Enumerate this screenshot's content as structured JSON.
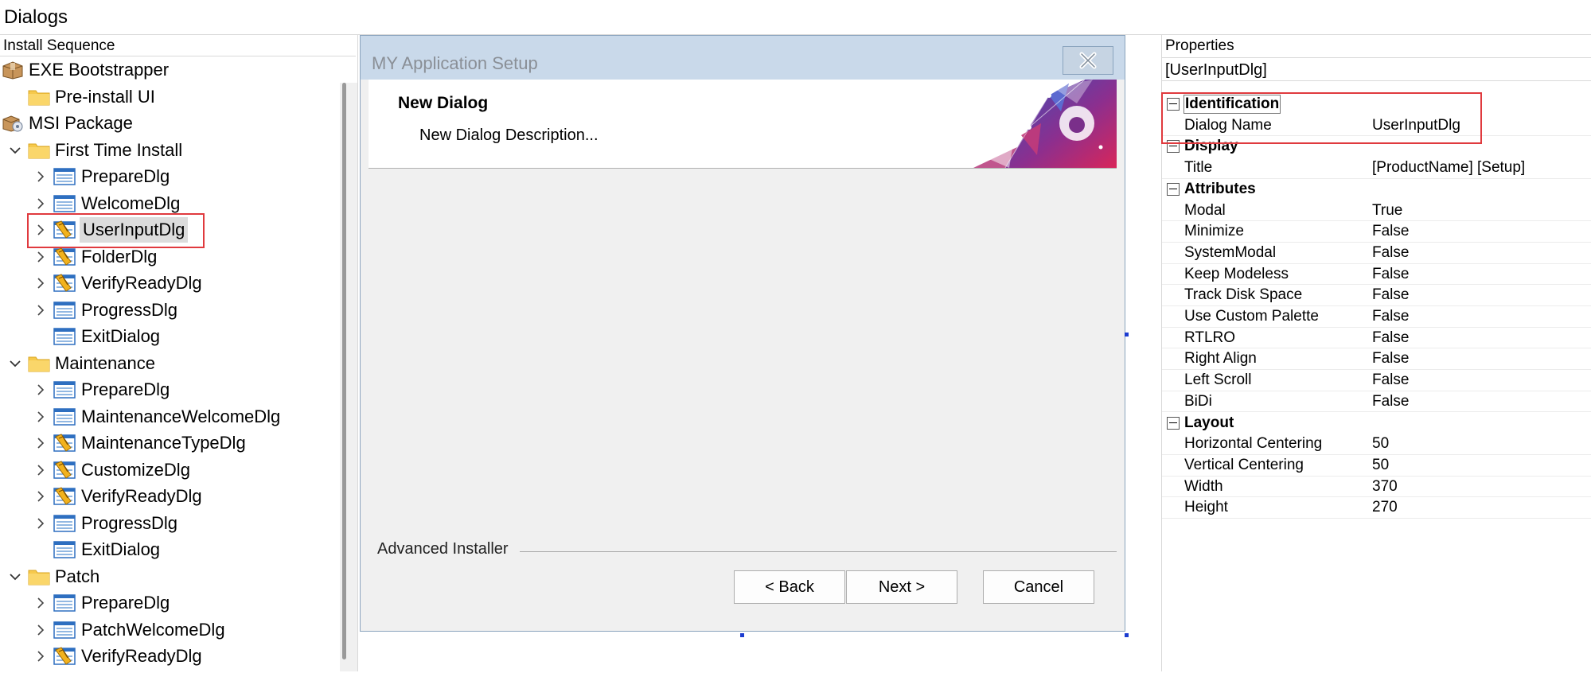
{
  "page": {
    "title": "Dialogs"
  },
  "left_panel": {
    "header": "Install Sequence",
    "tree": [
      {
        "label": "EXE Bootstrapper",
        "icon": "package-icon",
        "depth": 0,
        "chevron": "none"
      },
      {
        "label": "Pre-install UI",
        "icon": "folder-icon",
        "depth": 1,
        "chevron": "none"
      },
      {
        "label": "MSI Package",
        "icon": "msi-package-icon",
        "depth": 0,
        "chevron": "none"
      },
      {
        "label": "First Time Install",
        "icon": "folder-icon",
        "depth": 1,
        "chevron": "expanded"
      },
      {
        "label": "PrepareDlg",
        "icon": "dialog-icon",
        "depth": 2,
        "chevron": "collapsed"
      },
      {
        "label": "WelcomeDlg",
        "icon": "dialog-icon",
        "depth": 2,
        "chevron": "collapsed"
      },
      {
        "label": "UserInputDlg",
        "icon": "custom-dialog-icon",
        "depth": 2,
        "chevron": "collapsed",
        "selected": true
      },
      {
        "label": "FolderDlg",
        "icon": "custom-dialog-icon",
        "depth": 2,
        "chevron": "collapsed"
      },
      {
        "label": "VerifyReadyDlg",
        "icon": "custom-dialog-icon",
        "depth": 2,
        "chevron": "collapsed"
      },
      {
        "label": "ProgressDlg",
        "icon": "dialog-icon",
        "depth": 2,
        "chevron": "collapsed"
      },
      {
        "label": "ExitDialog",
        "icon": "dialog-icon",
        "depth": 2,
        "chevron": "none"
      },
      {
        "label": "Maintenance",
        "icon": "folder-icon",
        "depth": 1,
        "chevron": "expanded"
      },
      {
        "label": "PrepareDlg",
        "icon": "dialog-icon",
        "depth": 2,
        "chevron": "collapsed"
      },
      {
        "label": "MaintenanceWelcomeDlg",
        "icon": "dialog-icon",
        "depth": 2,
        "chevron": "collapsed"
      },
      {
        "label": "MaintenanceTypeDlg",
        "icon": "custom-dialog-icon",
        "depth": 2,
        "chevron": "collapsed"
      },
      {
        "label": "CustomizeDlg",
        "icon": "custom-dialog-icon",
        "depth": 2,
        "chevron": "collapsed"
      },
      {
        "label": "VerifyReadyDlg",
        "icon": "custom-dialog-icon",
        "depth": 2,
        "chevron": "collapsed"
      },
      {
        "label": "ProgressDlg",
        "icon": "dialog-icon",
        "depth": 2,
        "chevron": "collapsed"
      },
      {
        "label": "ExitDialog",
        "icon": "dialog-icon",
        "depth": 2,
        "chevron": "none"
      },
      {
        "label": "Patch",
        "icon": "folder-icon",
        "depth": 1,
        "chevron": "expanded"
      },
      {
        "label": "PrepareDlg",
        "icon": "dialog-icon",
        "depth": 2,
        "chevron": "collapsed"
      },
      {
        "label": "PatchWelcomeDlg",
        "icon": "dialog-icon",
        "depth": 2,
        "chevron": "collapsed"
      },
      {
        "label": "VerifyReadyDlg",
        "icon": "custom-dialog-icon",
        "depth": 2,
        "chevron": "collapsed"
      }
    ]
  },
  "dialog": {
    "window_title": "MY Application Setup",
    "banner_title": "New Dialog",
    "banner_description": "New Dialog Description...",
    "footer_label": "Advanced Installer",
    "buttons": {
      "back": "< Back",
      "next": "Next >",
      "cancel": "Cancel"
    }
  },
  "properties": {
    "header": "Properties",
    "selected_object": "[UserInputDlg]",
    "categories": [
      {
        "name": "Identification",
        "rows": [
          {
            "name": "Dialog Name",
            "value": "UserInputDlg"
          }
        ]
      },
      {
        "name": "Display",
        "rows": [
          {
            "name": "Title",
            "value": "[ProductName] [Setup]"
          }
        ]
      },
      {
        "name": "Attributes",
        "rows": [
          {
            "name": "Modal",
            "value": "True"
          },
          {
            "name": "Minimize",
            "value": "False"
          },
          {
            "name": "SystemModal",
            "value": "False"
          },
          {
            "name": "Keep Modeless",
            "value": "False"
          },
          {
            "name": "Track Disk Space",
            "value": "False"
          },
          {
            "name": "Use Custom Palette",
            "value": "False"
          },
          {
            "name": "RTLRO",
            "value": "False"
          },
          {
            "name": "Right Align",
            "value": "False"
          },
          {
            "name": "Left Scroll",
            "value": "False"
          },
          {
            "name": "BiDi",
            "value": "False"
          }
        ]
      },
      {
        "name": "Layout",
        "rows": [
          {
            "name": "Horizontal Centering",
            "value": "50"
          },
          {
            "name": "Vertical Centering",
            "value": "50"
          },
          {
            "name": "Width",
            "value": "370"
          },
          {
            "name": "Height",
            "value": "270"
          }
        ]
      }
    ]
  },
  "colors": {
    "highlight_box": "#e03a3e",
    "selection": "#dcdcdc",
    "titlebar": "#c9d9ea"
  }
}
